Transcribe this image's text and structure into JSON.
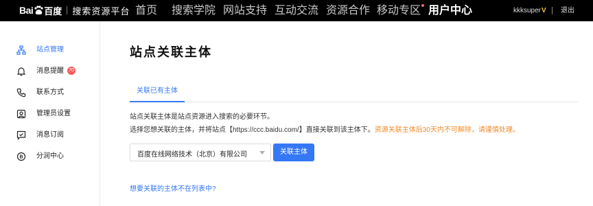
{
  "brand": {
    "bai": "Bai",
    "du": "百度",
    "platform": "搜索资源平台"
  },
  "nav": {
    "items": [
      {
        "label": "首页"
      },
      {
        "label": "搜索学院"
      },
      {
        "label": "网站支持"
      },
      {
        "label": "互动交流"
      },
      {
        "label": "资源合作"
      },
      {
        "label": "移动专区"
      },
      {
        "label": "用户中心"
      }
    ],
    "username": "kkksuper",
    "logout": "退出"
  },
  "sidebar": {
    "items": [
      {
        "label": "站点管理"
      },
      {
        "label": "消息提醒",
        "badge": "70"
      },
      {
        "label": "联系方式"
      },
      {
        "label": "管理员设置"
      },
      {
        "label": "消息订阅"
      },
      {
        "label": "分润中心"
      }
    ]
  },
  "main": {
    "title": "站点关联主体",
    "tab": "关联已有主体",
    "desc1": "站点关联主体是站点资源进入搜索的必要环节。",
    "desc2": "选择您想关联的主体，并将站点【https://ccc.baidu.com/】直接关联到该主体下。",
    "warning": "资源关联主体后30天内不可解除，请谨慎处理。",
    "select_value": "百度在线网络技术（北京）有限公司",
    "button": "关联主体",
    "link": "想要关联的主体不在列表中?"
  },
  "colors": {
    "accent": "#3478f6",
    "warning": "#f28a2a",
    "badge": "#f25d5d",
    "topbar": "#000000"
  }
}
